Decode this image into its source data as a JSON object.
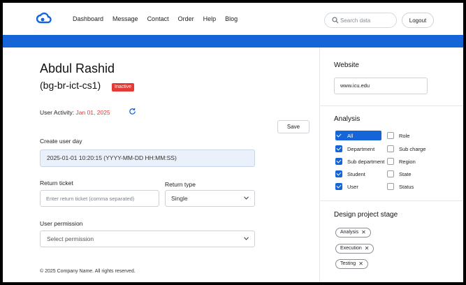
{
  "nav": {
    "items": [
      "Dashboard",
      "Message",
      "Contact",
      "Order",
      "Help",
      "Blog"
    ],
    "search_placeholder": "Search data",
    "logout_label": "Logout"
  },
  "colors": {
    "brand": "#1565d8",
    "badge": "#e53935"
  },
  "profile": {
    "name": "Abdul Rashid",
    "handle": "(bg-br-ict-cs1)",
    "status": "Inactive",
    "activity_label": "User Activity:",
    "activity_date": "Jan 01, 2025"
  },
  "form": {
    "save_label": "Save",
    "create_label": "Create user day",
    "create_value": "2025-01-01 10:20:15  (YYYY-MM-DD HH:MM:SS)",
    "return_ticket_label": "Return ticket",
    "return_ticket_placeholder": "Enter return ticket (comma separated)",
    "return_type_label": "Return type",
    "return_type_value": "Single",
    "permission_label": "User permission",
    "permission_value": "Select permission"
  },
  "footer": {
    "text": "© 2025 Company Name. All rights reserved."
  },
  "sidebar": {
    "website_title": "Website",
    "website_value": "www.icu.edu",
    "analysis_title": "Analysis",
    "analysis_left": [
      {
        "label": "All",
        "checked": true
      },
      {
        "label": "Department",
        "checked": true
      },
      {
        "label": "Sub department",
        "checked": true
      },
      {
        "label": "Student",
        "checked": true
      },
      {
        "label": "User",
        "checked": true
      }
    ],
    "analysis_right": [
      {
        "label": "Role",
        "checked": false
      },
      {
        "label": "Sub charge",
        "checked": false
      },
      {
        "label": "Region",
        "checked": false
      },
      {
        "label": "State",
        "checked": false
      },
      {
        "label": "Status",
        "checked": false
      }
    ],
    "stage_title": "Design project stage",
    "stages": [
      "Analysis",
      "Execution",
      "Testing"
    ]
  }
}
